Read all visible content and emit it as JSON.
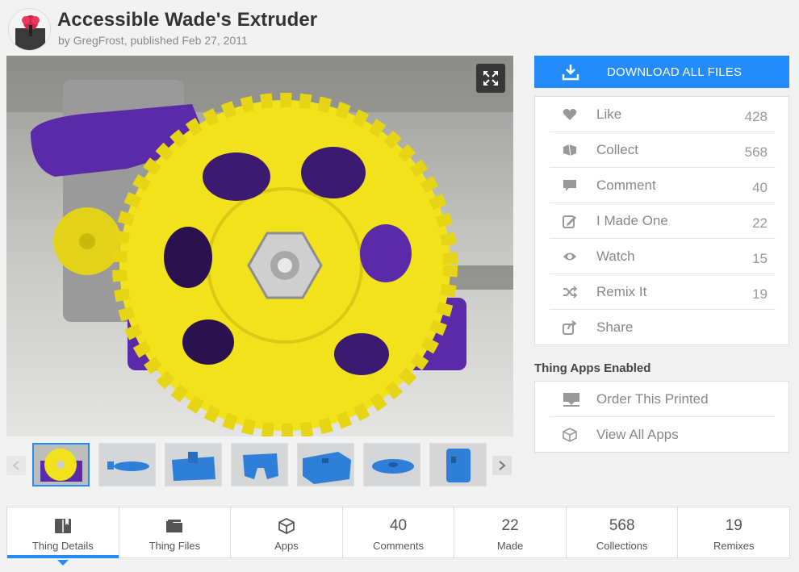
{
  "header": {
    "title": "Accessible Wade's Extruder",
    "by_prefix": "by ",
    "author": "GregFrost",
    "published_prefix": ", published ",
    "date": "Feb 27, 2011"
  },
  "download": {
    "label": "DOWNLOAD ALL FILES",
    "icon": "download-icon"
  },
  "actions": [
    {
      "label": "Like",
      "count": "428",
      "icon": "heart-icon"
    },
    {
      "label": "Collect",
      "count": "568",
      "icon": "collect-icon"
    },
    {
      "label": "Comment",
      "count": "40",
      "icon": "comment-icon"
    },
    {
      "label": "I Made One",
      "count": "22",
      "icon": "made-one-icon"
    },
    {
      "label": "Watch",
      "count": "15",
      "icon": "eye-icon"
    },
    {
      "label": "Remix It",
      "count": "19",
      "icon": "remix-icon"
    },
    {
      "label": "Share",
      "count": "",
      "icon": "share-icon"
    }
  ],
  "apps": {
    "heading": "Thing Apps Enabled",
    "items": [
      {
        "label": "Order This Printed",
        "icon": "printer-icon"
      },
      {
        "label": "View All Apps",
        "icon": "cube-icon"
      }
    ]
  },
  "tabs": [
    {
      "label": "Thing Details",
      "icon": "book-icon"
    },
    {
      "label": "Thing Files",
      "icon": "folder-icon"
    },
    {
      "label": "Apps",
      "icon": "cube-icon"
    },
    {
      "label": "Comments",
      "number": "40"
    },
    {
      "label": "Made",
      "number": "22"
    },
    {
      "label": "Collections",
      "number": "568"
    },
    {
      "label": "Remixes",
      "number": "19"
    }
  ],
  "colors": {
    "accent": "#248bfb",
    "gear": "#f2e21c",
    "part": "#5a2aa8",
    "render_blue": "#2f7fd8"
  }
}
